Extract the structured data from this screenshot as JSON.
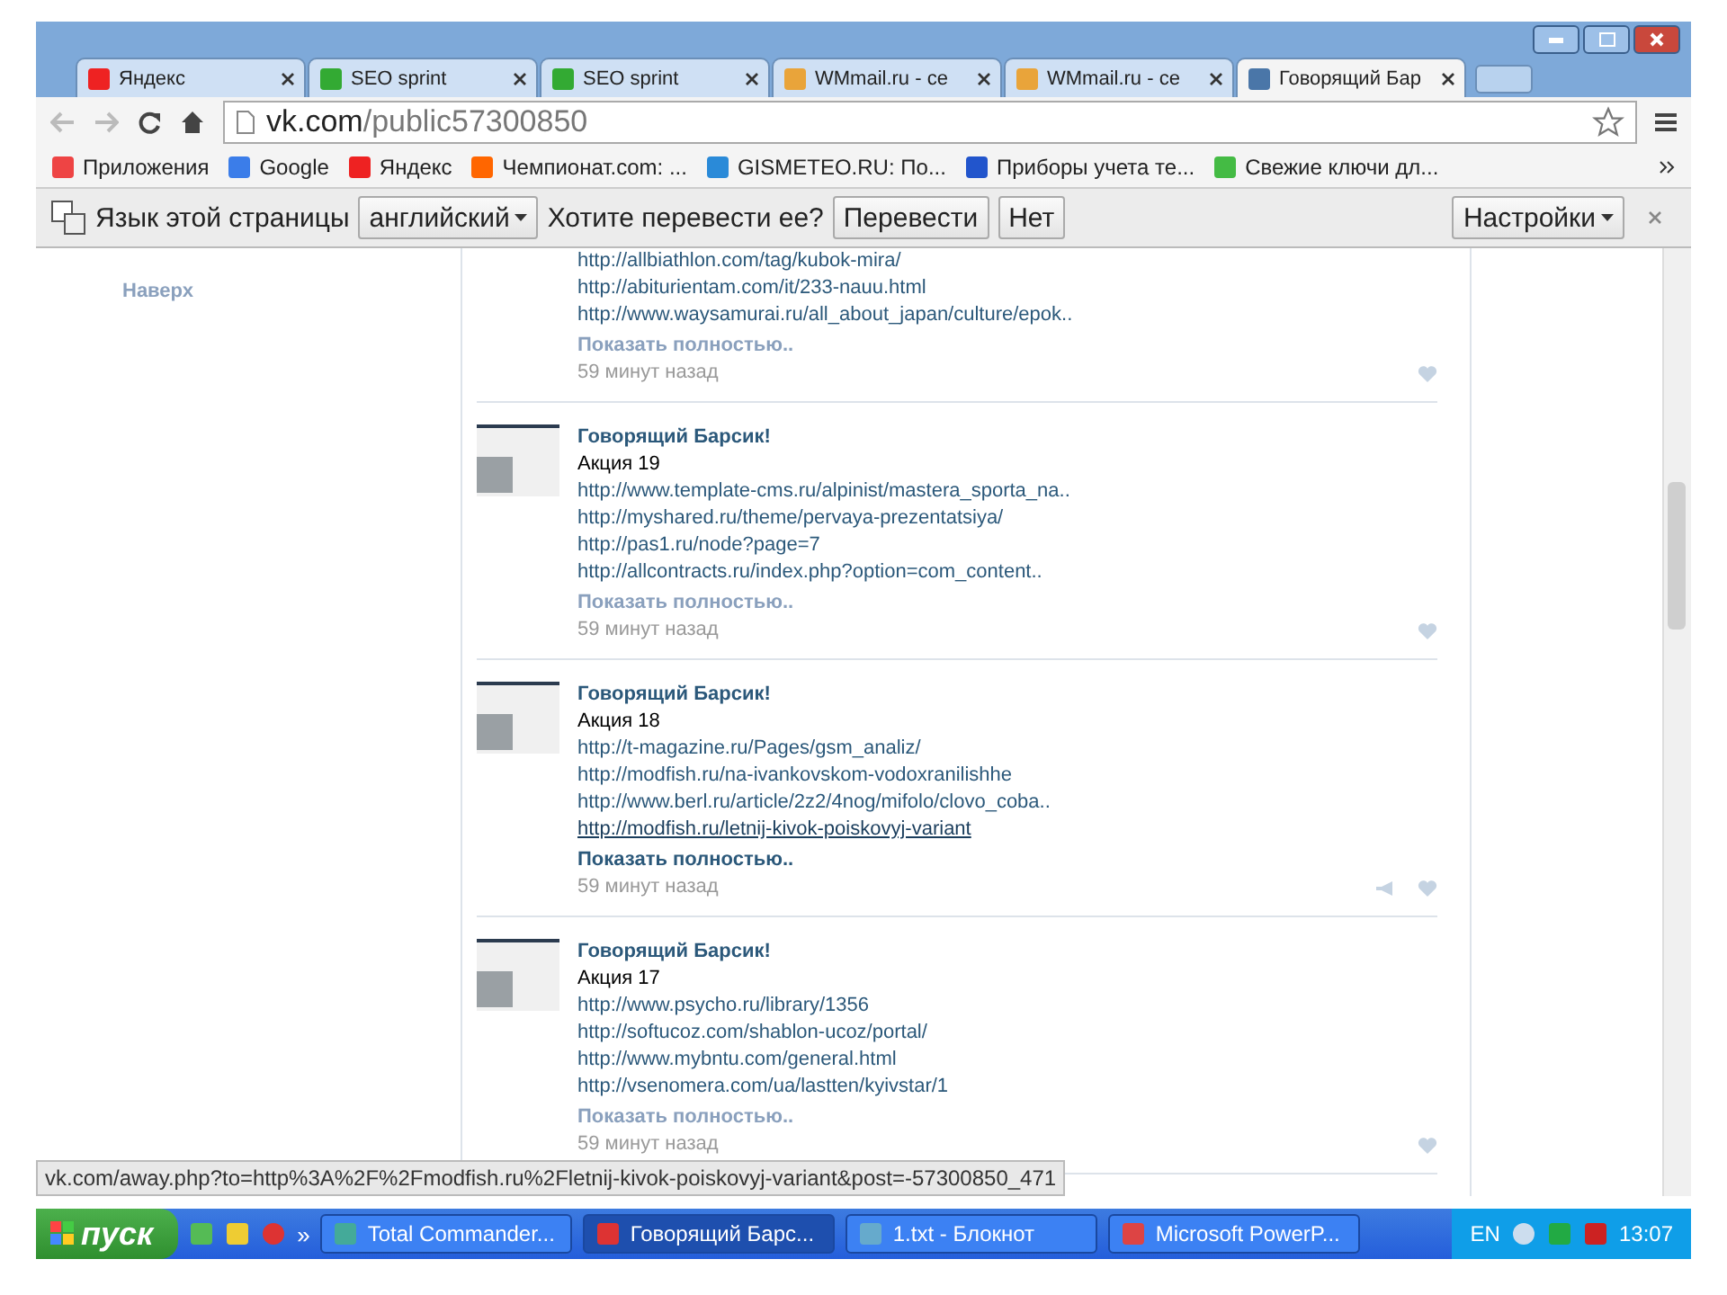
{
  "tabs": [
    {
      "title": "Яндекс",
      "selected": false
    },
    {
      "title": "SEO sprint",
      "selected": false
    },
    {
      "title": "SEO sprint",
      "selected": false
    },
    {
      "title": "WMmail.ru - се",
      "selected": false
    },
    {
      "title": "WMmail.ru - се",
      "selected": false
    },
    {
      "title": "Говорящий Бар",
      "selected": true
    }
  ],
  "address": {
    "host": "vk.com",
    "path": "/public57300850"
  },
  "bookmarks": [
    "Приложения",
    "Google",
    "Яндекс",
    "Чемпионат.com: ...",
    "GISMETEO.RU: По...",
    "Приборы учета те...",
    "Свежие ключи дл..."
  ],
  "translate": {
    "label": "Язык этой страницы",
    "language": "английский",
    "question": "Хотите перевести ее?",
    "translate_button": "Перевести",
    "no_button": "Нет",
    "settings_button": "Настройки"
  },
  "sidebar": {
    "top_link": "Наверх"
  },
  "posts": [
    {
      "links": [
        {
          "text": "http://allbiathlon.com/tag/kubok-mira/",
          "hovered": false
        },
        {
          "text": "http://abiturientam.com/it/233-nauu.html",
          "hovered": false
        },
        {
          "text": "http://www.waysamurai.ru/all_about_japan/culture/epok..",
          "hovered": false
        }
      ],
      "more": {
        "text": "Показать полностью..",
        "hovered": false
      },
      "time": "59 минут назад",
      "repost_icon": false
    },
    {
      "author": "Говорящий Барсик!",
      "title": "Акция 19",
      "links": [
        {
          "text": "http://www.template-cms.ru/alpinist/mastera_sporta_na..",
          "hovered": false
        },
        {
          "text": "http://myshared.ru/theme/pervaya-prezentatsiya/",
          "hovered": false
        },
        {
          "text": "http://pas1.ru/node?page=7",
          "hovered": false
        },
        {
          "text": "http://allcontracts.ru/index.php?option=com_content..",
          "hovered": false
        }
      ],
      "more": {
        "text": "Показать полностью..",
        "hovered": false
      },
      "time": "59 минут назад",
      "repost_icon": false
    },
    {
      "author": "Говорящий Барсик!",
      "title": "Акция 18",
      "links": [
        {
          "text": "http://t-magazine.ru/Pages/gsm_analiz/",
          "hovered": false
        },
        {
          "text": "http://modfish.ru/na-ivankovskom-vodoxranilishhe",
          "hovered": false
        },
        {
          "text": "http://www.berl.ru/article/2z2/4nog/mifolo/clovo_coba..",
          "hovered": false
        },
        {
          "text": "http://modfish.ru/letnij-kivok-poiskovyj-variant",
          "hovered": true
        }
      ],
      "more": {
        "text": "Показать полностью..",
        "hovered": true
      },
      "time": "59 минут назад",
      "repost_icon": true
    },
    {
      "author": "Говорящий Барсик!",
      "title": "Акция 17",
      "links": [
        {
          "text": "http://www.psycho.ru/library/1356",
          "hovered": false
        },
        {
          "text": "http://softucoz.com/shablon-ucoz/portal/",
          "hovered": false
        },
        {
          "text": "http://www.mybntu.com/general.html",
          "hovered": false
        },
        {
          "text": "http://vsenomera.com/ua/lastten/kyivstar/1",
          "hovered": false
        }
      ],
      "more": {
        "text": "Показать полностью..",
        "hovered": false
      },
      "time": "59 минут назад",
      "repost_icon": false
    }
  ],
  "status_url": "vk.com/away.php?to=http%3A%2F%2Fmodfish.ru%2Fletnij-kivok-poiskovyj-variant&post=-57300850_471",
  "taskbar": {
    "start": "пуск",
    "quick_launch_more": "»",
    "items": [
      {
        "label": "Total Commander...",
        "selected": false
      },
      {
        "label": "Говорящий Барс...",
        "selected": true
      },
      {
        "label": "1.txt - Блокнот",
        "selected": false
      },
      {
        "label": "Microsoft PowerP...",
        "selected": false
      }
    ],
    "lang": "EN",
    "clock": "13:07"
  }
}
